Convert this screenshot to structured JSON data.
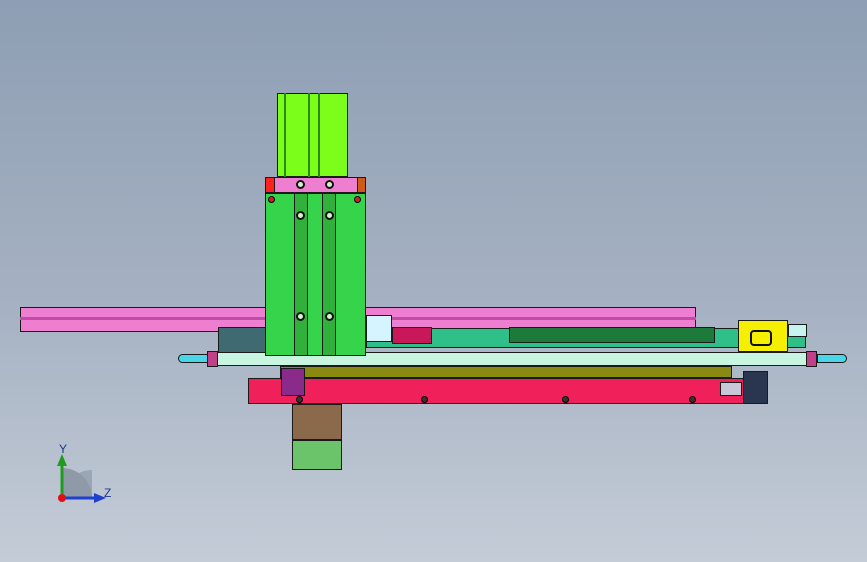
{
  "viewport": {
    "background_top": "#8e9eb3",
    "background_bottom": "#c4ccd7"
  },
  "axis_triad": {
    "y_label": "Y",
    "z_label": "Z",
    "y_color": "#1f9b1f",
    "z_color": "#1f3fd0",
    "origin_color": "#e01010"
  },
  "colors": {
    "motor": "#7bff1a",
    "carriage": "#36d44a",
    "pink_rail": "#ee7fd0",
    "red_base": "#f0205a",
    "olive_rail": "#8a8a10",
    "teal_plate": "#2fc08a",
    "dark_green": "#1d7a3a",
    "light_rail": "#c8f5e0",
    "yellow_block": "#f4f000",
    "brown_block": "#8a6a4a",
    "bottom_block": "#6cc46a"
  }
}
